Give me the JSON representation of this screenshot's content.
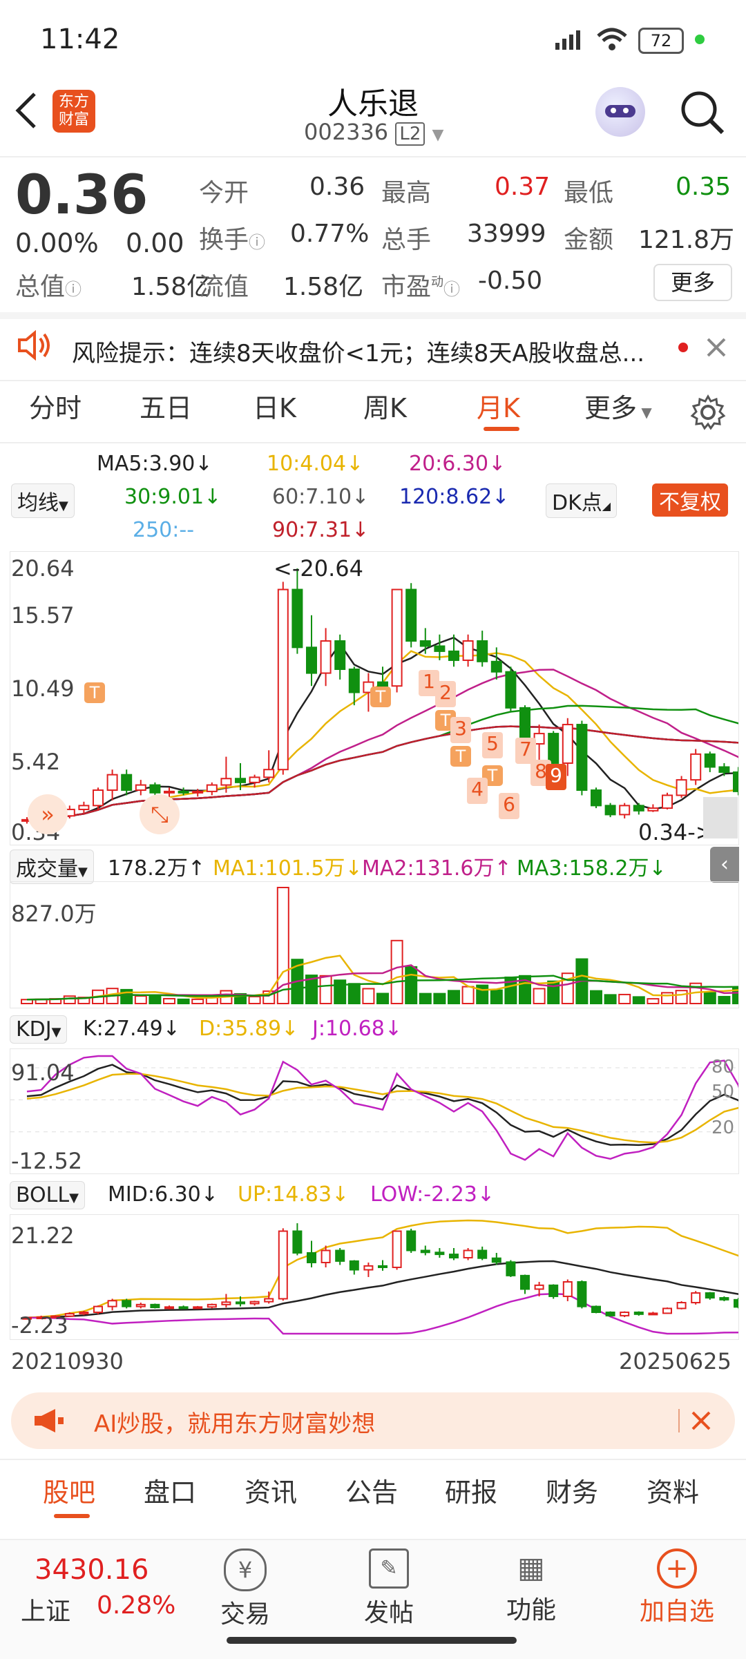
{
  "status_bar": {
    "time": "11:42",
    "battery": "72"
  },
  "header": {
    "title": "人乐退",
    "code": "002336",
    "level": "L2",
    "app_logo_text": "东方财富"
  },
  "quote": {
    "price": "0.36",
    "change_pct": "0.00%",
    "change": "0.00",
    "open_label": "今开",
    "open": "0.36",
    "high_label": "最高",
    "high": "0.37",
    "low_label": "最低",
    "low": "0.35",
    "turnover_label": "换手",
    "turnover": "0.77%",
    "volume_label": "总手",
    "volume": "33999",
    "amount_label": "金额",
    "amount": "121.8万",
    "mktcap_label": "总值",
    "mktcap": "1.58亿",
    "float_label": "流值",
    "float": "1.58亿",
    "pe_label": "市盈",
    "pe_sup": "动",
    "pe": "-0.50",
    "more_label": "更多"
  },
  "risk": {
    "text": "风险提示：连续8天收盘价<1元；连续8天A股收盘总..."
  },
  "tabs": [
    {
      "label": "分时"
    },
    {
      "label": "五日"
    },
    {
      "label": "日K"
    },
    {
      "label": "周K"
    },
    {
      "label": "月K"
    },
    {
      "label": "更多"
    }
  ],
  "ma": {
    "ma5": "MA5:3.90↓",
    "ma10": "10:4.04↓",
    "ma20": "20:6.30↓",
    "ma30": "30:9.01↓",
    "ma60": "60:7.10↓",
    "ma120": "120:8.62↓",
    "ma250": "250:--",
    "ma90": "90:7.31↓",
    "selector": "均线",
    "dk": "DK点",
    "fq": "不复权"
  },
  "kchart": {
    "ymax": "20.64",
    "y2": "15.57",
    "y3": "10.49",
    "y4": "5.42",
    "ymin": "0.34",
    "high_marker": "<-20.64",
    "low_marker": "0.34->"
  },
  "volume": {
    "selector": "成交量",
    "value": "178.2万↑",
    "ma1": "MA1:101.5万↓",
    "ma2": "MA2:131.6万↑",
    "ma3": "MA3:158.2万↓",
    "ymax": "827.0万"
  },
  "kdj": {
    "selector": "KDJ",
    "k": "K:27.49↓",
    "d": "D:35.89↓",
    "j": "J:10.68↓",
    "ymax": "91.04",
    "ymin": "-12.52",
    "l80": "80",
    "l50": "50",
    "l20": "20"
  },
  "boll": {
    "selector": "BOLL",
    "mid": "MID:6.30↓",
    "up": "UP:14.83↓",
    "low": "LOW:-2.23↓",
    "ymax": "21.22",
    "ymin": "-2.23"
  },
  "dates": {
    "start": "20210930",
    "end": "20250625"
  },
  "ad": {
    "text": "AI炒股，就用东方财富妙想"
  },
  "bottom_tabs": [
    {
      "label": "股吧"
    },
    {
      "label": "盘口"
    },
    {
      "label": "资讯"
    },
    {
      "label": "公告"
    },
    {
      "label": "研报"
    },
    {
      "label": "财务"
    },
    {
      "label": "资料"
    }
  ],
  "nav": {
    "index_value": "3430.16",
    "index_name": "上证",
    "index_change": "0.28%",
    "trade": "交易",
    "post": "发帖",
    "func": "功能",
    "add": "加自选"
  },
  "signals": {
    "t": "T",
    "n1": "1",
    "n2": "2",
    "n3": "3",
    "n4": "4",
    "n5": "5",
    "n6": "6",
    "n7": "7",
    "n8": "8",
    "n9": "9"
  },
  "chart_data": {
    "type": "candlestick",
    "title": "",
    "x_start": "20210930",
    "x_end": "20250625",
    "ylim": [
      0.34,
      20.64
    ],
    "candles": [
      {
        "o": 1.0,
        "h": 1.3,
        "l": 0.8,
        "c": 1.1
      },
      {
        "o": 1.1,
        "h": 1.5,
        "l": 0.9,
        "c": 1.2
      },
      {
        "o": 1.2,
        "h": 1.6,
        "l": 1.0,
        "c": 1.4
      },
      {
        "o": 1.4,
        "h": 2.2,
        "l": 1.2,
        "c": 1.9
      },
      {
        "o": 1.9,
        "h": 2.5,
        "l": 1.6,
        "c": 2.2
      },
      {
        "o": 2.2,
        "h": 3.6,
        "l": 1.8,
        "c": 3.4
      },
      {
        "o": 3.4,
        "h": 5.0,
        "l": 2.6,
        "c": 4.6
      },
      {
        "o": 4.6,
        "h": 5.0,
        "l": 3.0,
        "c": 3.4
      },
      {
        "o": 3.4,
        "h": 4.2,
        "l": 3.0,
        "c": 3.8
      },
      {
        "o": 3.8,
        "h": 4.0,
        "l": 3.0,
        "c": 3.2
      },
      {
        "o": 3.2,
        "h": 3.6,
        "l": 2.8,
        "c": 3.3
      },
      {
        "o": 3.3,
        "h": 3.6,
        "l": 3.0,
        "c": 3.2
      },
      {
        "o": 3.2,
        "h": 3.5,
        "l": 2.9,
        "c": 3.3
      },
      {
        "o": 3.3,
        "h": 4.0,
        "l": 3.0,
        "c": 3.8
      },
      {
        "o": 3.8,
        "h": 6.0,
        "l": 3.2,
        "c": 4.3
      },
      {
        "o": 4.3,
        "h": 5.5,
        "l": 3.4,
        "c": 4.0
      },
      {
        "o": 4.0,
        "h": 4.6,
        "l": 3.6,
        "c": 4.4
      },
      {
        "o": 4.4,
        "h": 6.5,
        "l": 4.0,
        "c": 5.0
      },
      {
        "o": 5.0,
        "h": 19.6,
        "l": 4.6,
        "c": 19.0
      },
      {
        "o": 19.0,
        "h": 20.64,
        "l": 14.0,
        "c": 14.5
      },
      {
        "o": 14.5,
        "h": 17.0,
        "l": 11.5,
        "c": 12.5
      },
      {
        "o": 12.5,
        "h": 16.0,
        "l": 11.5,
        "c": 15.0
      },
      {
        "o": 15.0,
        "h": 15.5,
        "l": 12.0,
        "c": 12.8
      },
      {
        "o": 12.8,
        "h": 13.0,
        "l": 10.0,
        "c": 11.0
      },
      {
        "o": 11.0,
        "h": 12.5,
        "l": 9.5,
        "c": 11.8
      },
      {
        "o": 11.8,
        "h": 13.0,
        "l": 10.8,
        "c": 11.5
      },
      {
        "o": 11.5,
        "h": 19.0,
        "l": 11.0,
        "c": 19.0
      },
      {
        "o": 19.0,
        "h": 19.5,
        "l": 14.5,
        "c": 15.0
      },
      {
        "o": 15.0,
        "h": 16.0,
        "l": 14.0,
        "c": 14.6
      },
      {
        "o": 14.6,
        "h": 15.5,
        "l": 13.5,
        "c": 14.2
      },
      {
        "o": 14.2,
        "h": 15.5,
        "l": 13.0,
        "c": 13.5
      },
      {
        "o": 13.5,
        "h": 15.5,
        "l": 13.0,
        "c": 15.0
      },
      {
        "o": 15.0,
        "h": 15.8,
        "l": 13.0,
        "c": 13.4
      },
      {
        "o": 13.4,
        "h": 14.5,
        "l": 12.0,
        "c": 12.6
      },
      {
        "o": 12.6,
        "h": 13.0,
        "l": 9.5,
        "c": 9.8
      },
      {
        "o": 9.8,
        "h": 10.0,
        "l": 6.0,
        "c": 7.0
      },
      {
        "o": 7.0,
        "h": 8.5,
        "l": 5.5,
        "c": 7.8
      },
      {
        "o": 7.8,
        "h": 8.0,
        "l": 5.0,
        "c": 5.5
      },
      {
        "o": 5.5,
        "h": 9.0,
        "l": 4.5,
        "c": 8.5
      },
      {
        "o": 8.5,
        "h": 8.8,
        "l": 3.0,
        "c": 3.4
      },
      {
        "o": 3.4,
        "h": 3.6,
        "l": 2.0,
        "c": 2.2
      },
      {
        "o": 2.2,
        "h": 2.4,
        "l": 1.3,
        "c": 1.5
      },
      {
        "o": 1.5,
        "h": 2.4,
        "l": 1.2,
        "c": 2.2
      },
      {
        "o": 2.2,
        "h": 2.4,
        "l": 1.5,
        "c": 1.8
      },
      {
        "o": 1.8,
        "h": 2.3,
        "l": 1.7,
        "c": 2.0
      },
      {
        "o": 2.0,
        "h": 3.2,
        "l": 1.9,
        "c": 3.0
      },
      {
        "o": 3.0,
        "h": 4.5,
        "l": 2.8,
        "c": 4.2
      },
      {
        "o": 4.2,
        "h": 6.6,
        "l": 3.8,
        "c": 6.2
      },
      {
        "o": 6.2,
        "h": 6.4,
        "l": 4.8,
        "c": 5.2
      },
      {
        "o": 5.2,
        "h": 5.5,
        "l": 4.5,
        "c": 4.8
      },
      {
        "o": 4.8,
        "h": 5.2,
        "l": 3.0,
        "c": 3.3
      },
      {
        "o": 3.3,
        "h": 3.4,
        "l": 0.35,
        "c": 0.36
      }
    ],
    "volume_ymax": "827.0万",
    "kdj_range": [
      -12.52,
      91.04
    ],
    "boll_range": [
      -2.23,
      21.22
    ]
  }
}
